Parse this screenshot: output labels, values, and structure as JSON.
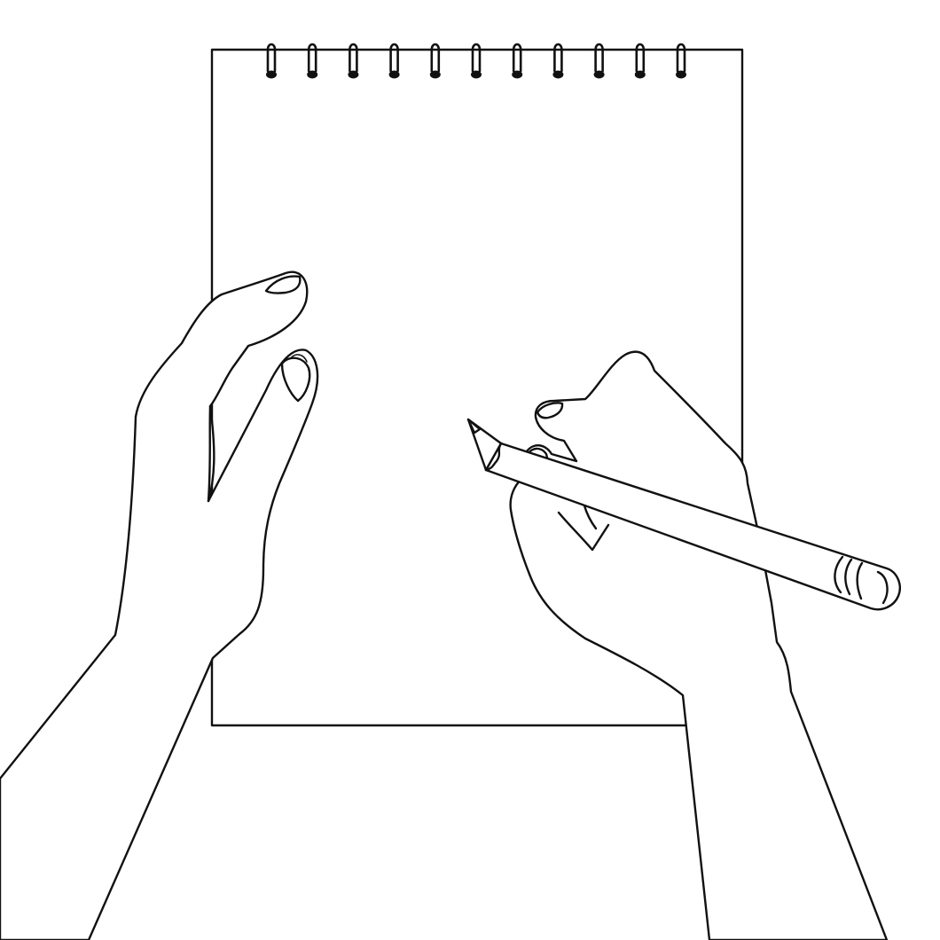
{
  "illustration": {
    "subject": "line-art",
    "background_color": "#ffffff",
    "line_color": "#111111",
    "notepad": {
      "binding": "spiral",
      "ring_count": 11,
      "page_state": "blank"
    },
    "pencil": {
      "tip": "sharpened",
      "end": "eraser"
    }
  }
}
